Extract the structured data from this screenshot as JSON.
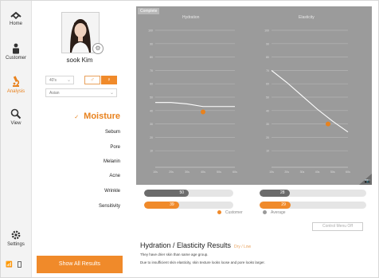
{
  "nav": {
    "items": [
      {
        "label": "Home",
        "icon": "home-icon"
      },
      {
        "label": "Customer",
        "icon": "person-icon"
      },
      {
        "label": "Analysis",
        "icon": "microscope-icon"
      },
      {
        "label": "View",
        "icon": "search-icon"
      }
    ],
    "settings_label": "Settings",
    "active_color": "#e8821e"
  },
  "profile": {
    "name": "sook Kim",
    "age_select": "40's",
    "region_select": "Asian",
    "gender_male": "♂",
    "gender_female": "♀"
  },
  "menu": {
    "active": "Moisture",
    "items": [
      "Sebum",
      "Pore",
      "Melanin",
      "Acne",
      "Wrinkle",
      "Sensitivity"
    ]
  },
  "show_all_button": "Show All Results",
  "chart_header": {
    "complete_label": "Complete"
  },
  "chart_data": [
    {
      "type": "line",
      "title": "Hydration",
      "ylim": [
        0,
        100
      ],
      "yticks": [
        "100",
        "90",
        "80",
        "70",
        "60",
        "50",
        "40",
        "30",
        "20",
        "10"
      ],
      "xticks": [
        "10s",
        "20s",
        "30s",
        "40s",
        "50s",
        "60s"
      ],
      "series": [
        {
          "x": [
            10,
            20,
            30,
            40,
            50,
            60
          ],
          "values": [
            46,
            46,
            45,
            43,
            43,
            43
          ]
        }
      ],
      "customer_point": {
        "x": 40,
        "y": 39
      }
    },
    {
      "type": "line",
      "title": "Elasticity",
      "ylim": [
        0,
        100
      ],
      "yticks": [
        "100",
        "90",
        "80",
        "70",
        "60",
        "50",
        "40",
        "30",
        "20",
        "10"
      ],
      "xticks": [
        "10s",
        "20s",
        "30s",
        "40s",
        "50s",
        "60s"
      ],
      "series": [
        {
          "x": [
            10,
            20,
            30,
            40,
            50,
            60
          ],
          "values": [
            70,
            61,
            51,
            41,
            32,
            24
          ]
        }
      ],
      "customer_point": {
        "x": 47,
        "y": 30
      }
    }
  ],
  "bars": {
    "hydration_average": 50,
    "hydration_customer": 39,
    "elasticity_average": 28,
    "elasticity_customer": 29,
    "average_color": "#6b6b6b",
    "customer_color": "#f08a2a"
  },
  "legend": {
    "customer": "Customer",
    "average": "Average"
  },
  "control_button": "Control Menu Off",
  "results": {
    "title": "Hydration / Elasticity Results",
    "status": "Dry / Low",
    "line1": "They have drier skin than same age group.",
    "line2": "Due to insufficient skin elasticity, skin texture looks loose and pore looks larger."
  }
}
